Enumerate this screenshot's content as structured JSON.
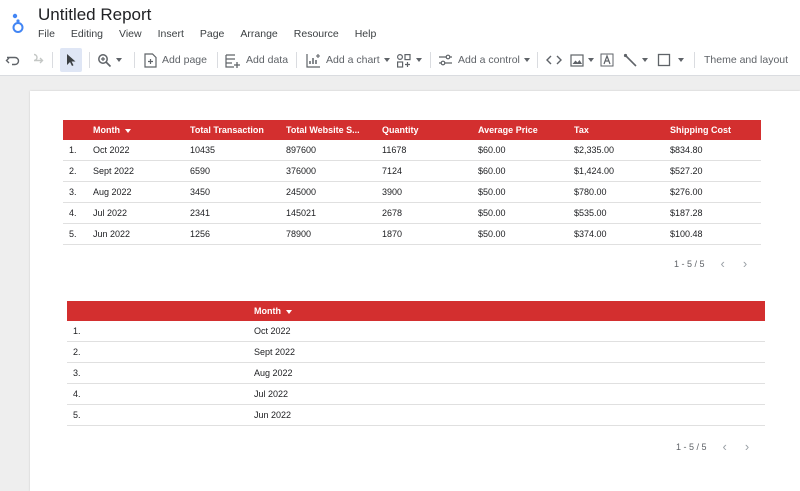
{
  "app": {
    "title": "Untitled Report",
    "menu": [
      "File",
      "Editing",
      "View",
      "Insert",
      "Page",
      "Arrange",
      "Resource",
      "Help"
    ]
  },
  "toolbar": {
    "add_page": "Add page",
    "add_data": "Add data",
    "add_chart": "Add a chart",
    "add_control": "Add a control",
    "theme_layout": "Theme and layout"
  },
  "table1": {
    "headers": [
      "Month",
      "Total Transaction",
      "Total Website S...",
      "Quantity",
      "Average Price",
      "Tax",
      "Shipping Cost"
    ],
    "rows": [
      [
        "1.",
        "Oct 2022",
        "10435",
        "897600",
        "11678",
        "$60.00",
        "$2,335.00",
        "$834.80"
      ],
      [
        "2.",
        "Sept 2022",
        "6590",
        "376000",
        "7124",
        "$60.00",
        "$1,424.00",
        "$527.20"
      ],
      [
        "3.",
        "Aug 2022",
        "3450",
        "245000",
        "3900",
        "$50.00",
        "$780.00",
        "$276.00"
      ],
      [
        "4.",
        "Jul 2022",
        "2341",
        "145021",
        "2678",
        "$50.00",
        "$535.00",
        "$187.28"
      ],
      [
        "5.",
        "Jun 2022",
        "1256",
        "78900",
        "1870",
        "$50.00",
        "$374.00",
        "$100.48"
      ]
    ],
    "pager": "1 - 5 / 5"
  },
  "table2": {
    "header": "Month",
    "rows": [
      [
        "1.",
        "Oct 2022"
      ],
      [
        "2.",
        "Sept 2022"
      ],
      [
        "3.",
        "Aug 2022"
      ],
      [
        "4.",
        "Jul 2022"
      ],
      [
        "5.",
        "Jun 2022"
      ]
    ],
    "pager": "1 - 5 / 5"
  },
  "colors": {
    "header_bg": "#d32f2f",
    "selection": "#dfe6f5"
  },
  "icons": [
    "looker-studio-logo",
    "undo-icon",
    "redo-icon",
    "select-pointer-icon",
    "zoom-icon",
    "add-page-icon",
    "add-data-icon",
    "chart-icon",
    "control-icon",
    "code-icon",
    "image-icon",
    "text-icon",
    "line-icon",
    "shape-icon"
  ]
}
